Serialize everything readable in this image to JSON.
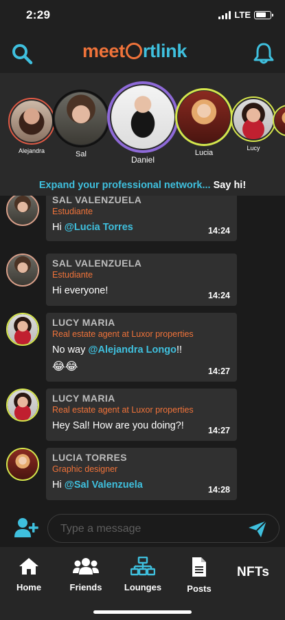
{
  "status_bar": {
    "time": "2:29",
    "carrier": "LTE"
  },
  "header": {
    "logo_part1": "meet",
    "logo_part2": "rtlink",
    "search_icon": "search-icon",
    "bell_icon": "bell-icon"
  },
  "stories": [
    {
      "name": "Alejandra",
      "ring_color": "#e05a45"
    },
    {
      "name": "Sal",
      "ring_color": "#111111"
    },
    {
      "name": "Daniel",
      "ring_color": "#8e6ad8"
    },
    {
      "name": "Lucia",
      "ring_color": "#d6e64c"
    },
    {
      "name": "Lucy",
      "ring_color": "#d6e64c"
    }
  ],
  "tagline": {
    "part1": "Expand your professional network...",
    "part2": "Say hi!"
  },
  "messages": [
    {
      "name": "SAL VALENZUELA",
      "role": "Estudiante",
      "text_prefix": "Hi ",
      "mention": "@Lucia Torres",
      "text_suffix": "",
      "time": "14:24"
    },
    {
      "name": "SAL VALENZUELA",
      "role": "Estudiante",
      "text_prefix": "Hi everyone!",
      "mention": "",
      "text_suffix": "",
      "time": "14:24"
    },
    {
      "name": "LUCY MARIA",
      "role": "Real estate agent at Luxor properties",
      "text_prefix": "No way ",
      "mention": "@Alejandra Longo",
      "text_suffix": "!!",
      "emoji": "😂😂",
      "time": "14:27"
    },
    {
      "name": "LUCY MARIA",
      "role": "Real estate agent at Luxor properties",
      "text_prefix": "Hey Sal! How are you doing?!",
      "mention": "",
      "text_suffix": "",
      "time": "14:27"
    },
    {
      "name": "LUCIA TORRES",
      "role": "Graphic designer",
      "text_prefix": "Hi ",
      "mention": "@Sal Valenzuela",
      "text_suffix": "",
      "time": "14:28"
    }
  ],
  "composer": {
    "placeholder": "Type a message"
  },
  "nav": {
    "home": "Home",
    "friends": "Friends",
    "lounges": "Lounges",
    "posts": "Posts",
    "nfts": "NFTs"
  },
  "colors": {
    "accent_orange": "#f0733a",
    "accent_cyan": "#3fc0de",
    "background": "#1b1b1b"
  }
}
